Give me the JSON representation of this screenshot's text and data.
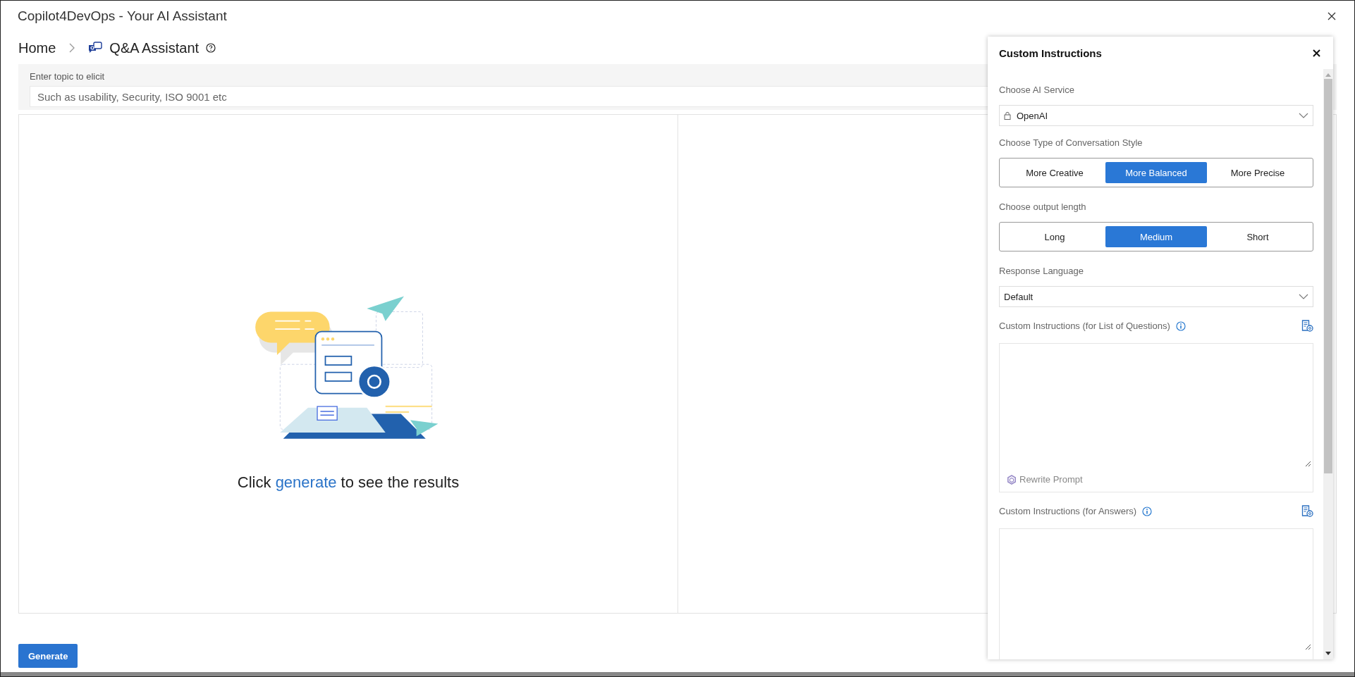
{
  "window": {
    "title": "Copilot4DevOps - Your AI Assistant"
  },
  "breadcrumb": {
    "home": "Home",
    "current": "Q&A Assistant"
  },
  "topic": {
    "label": "Enter topic to elicit",
    "placeholder": "Such as usability, Security, ISO 9001 etc"
  },
  "empty_state": {
    "before": "Click ",
    "link": "generate",
    "after": " to see the results"
  },
  "generate_button": "Generate",
  "panel": {
    "title": "Custom Instructions",
    "sections": [
      {
        "kind": "select",
        "label": "Choose AI Service",
        "value": "OpenAI",
        "locked": true
      },
      {
        "kind": "segmented",
        "label": "Choose Type of Conversation Style",
        "options": [
          {
            "label": "More Creative",
            "selected": false
          },
          {
            "label": "More Balanced",
            "selected": true
          },
          {
            "label": "More Precise",
            "selected": false
          }
        ]
      },
      {
        "kind": "segmented",
        "label": "Choose output length",
        "options": [
          {
            "label": "Long",
            "selected": false
          },
          {
            "label": "Medium",
            "selected": true
          },
          {
            "label": "Short",
            "selected": false
          }
        ]
      },
      {
        "kind": "select",
        "label": "Response Language",
        "value": "Default",
        "locked": false
      },
      {
        "kind": "textarea",
        "label": "Custom Instructions (for List of Questions)",
        "action": "Rewrite Prompt"
      },
      {
        "kind": "textarea",
        "label": "Custom Instructions (for Answers)"
      }
    ]
  }
}
